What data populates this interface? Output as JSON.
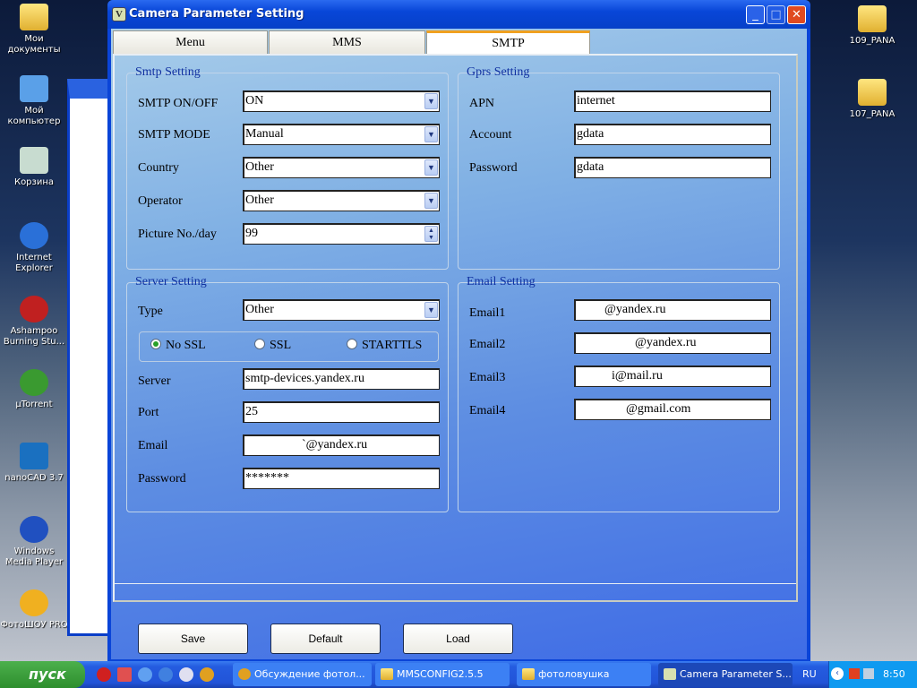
{
  "desktop": {
    "icons_left": [
      {
        "label": "Мои документы",
        "icon": "folder-documents-icon"
      },
      {
        "label": "Мой компьютер",
        "icon": "computer-icon"
      },
      {
        "label": "Корзина",
        "icon": "recycle-bin-icon"
      },
      {
        "label": "Internet Explorer",
        "icon": "ie-icon"
      },
      {
        "label": "Ashampoo Burning Stu...",
        "icon": "ashampoo-icon"
      },
      {
        "label": "µTorrent",
        "icon": "utorrent-icon"
      },
      {
        "label": "nanoCAD 3.7",
        "icon": "nanocad-icon"
      },
      {
        "label": "Windows Media Player",
        "icon": "wmp-icon"
      },
      {
        "label": "ФотоШОУ PRO",
        "icon": "fotoshow-icon"
      }
    ],
    "icons_right": [
      {
        "label": "109_PANA",
        "icon": "folder-icon"
      },
      {
        "label": "107_PANA",
        "icon": "folder-icon"
      }
    ]
  },
  "window": {
    "title": "Camera Parameter Setting",
    "tabs": [
      {
        "label": "Menu"
      },
      {
        "label": "MMS"
      },
      {
        "label": "SMTP",
        "selected": true
      }
    ],
    "smtp": {
      "title": "Smtp Setting",
      "fields": [
        {
          "label": "SMTP ON/OFF",
          "value": "ON"
        },
        {
          "label": "SMTP MODE",
          "value": "Manual"
        },
        {
          "label": "Country",
          "value": "Other"
        },
        {
          "label": "Operator",
          "value": "Other"
        },
        {
          "label": "Picture No./day",
          "value": "99"
        }
      ]
    },
    "gprs": {
      "title": "Gprs Setting",
      "fields": [
        {
          "label": "APN",
          "value": "internet"
        },
        {
          "label": "Account",
          "value": "gdata"
        },
        {
          "label": "Password",
          "value": "gdata"
        }
      ]
    },
    "server": {
      "title": "Server Setting",
      "type_label": "Type",
      "type_value": "Other",
      "ssl_options": [
        {
          "label": "No SSL",
          "checked": true
        },
        {
          "label": "SSL",
          "checked": false
        },
        {
          "label": "STARTTLS",
          "checked": false
        }
      ],
      "fields": [
        {
          "label": "Server",
          "value": "smtp-devices.yandex.ru"
        },
        {
          "label": "Port",
          "value": "25"
        },
        {
          "label": "Email",
          "value": "`@yandex.ru"
        },
        {
          "label": "Password",
          "value": "*******"
        }
      ]
    },
    "email": {
      "title": "Email Setting",
      "fields": [
        {
          "label": "Email1",
          "value": "@yandex.ru"
        },
        {
          "label": "Email2",
          "value": "@yandex.ru"
        },
        {
          "label": "Email3",
          "value": "i@mail.ru"
        },
        {
          "label": "Email4",
          "value": "@gmail.com"
        }
      ]
    },
    "buttons": {
      "save": "Save",
      "default": "Default",
      "load": "Load"
    }
  },
  "taskbar": {
    "start": "пуск",
    "tasks": [
      {
        "label": "Обсуждение фотол..."
      },
      {
        "label": "MMSCONFIG2.5.5"
      },
      {
        "label": "фотоловушка"
      },
      {
        "label": "Camera Parameter S..."
      }
    ],
    "lang": "RU",
    "clock": "8:50"
  },
  "colors": {
    "tab_accent": "#f0a020",
    "group_title": "#1030a0",
    "titlebar": "#0846d8"
  }
}
